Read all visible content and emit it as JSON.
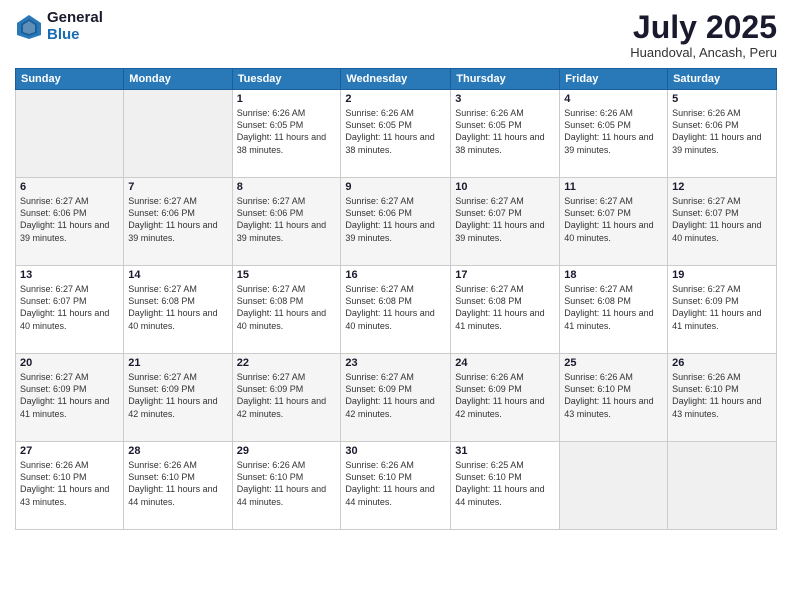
{
  "logo": {
    "general": "General",
    "blue": "Blue"
  },
  "title": "July 2025",
  "location": "Huandoval, Ancash, Peru",
  "days_of_week": [
    "Sunday",
    "Monday",
    "Tuesday",
    "Wednesday",
    "Thursday",
    "Friday",
    "Saturday"
  ],
  "weeks": [
    [
      {
        "day": "",
        "sunrise": "",
        "sunset": "",
        "daylight": ""
      },
      {
        "day": "",
        "sunrise": "",
        "sunset": "",
        "daylight": ""
      },
      {
        "day": "1",
        "sunrise": "Sunrise: 6:26 AM",
        "sunset": "Sunset: 6:05 PM",
        "daylight": "Daylight: 11 hours and 38 minutes."
      },
      {
        "day": "2",
        "sunrise": "Sunrise: 6:26 AM",
        "sunset": "Sunset: 6:05 PM",
        "daylight": "Daylight: 11 hours and 38 minutes."
      },
      {
        "day": "3",
        "sunrise": "Sunrise: 6:26 AM",
        "sunset": "Sunset: 6:05 PM",
        "daylight": "Daylight: 11 hours and 38 minutes."
      },
      {
        "day": "4",
        "sunrise": "Sunrise: 6:26 AM",
        "sunset": "Sunset: 6:05 PM",
        "daylight": "Daylight: 11 hours and 39 minutes."
      },
      {
        "day": "5",
        "sunrise": "Sunrise: 6:26 AM",
        "sunset": "Sunset: 6:06 PM",
        "daylight": "Daylight: 11 hours and 39 minutes."
      }
    ],
    [
      {
        "day": "6",
        "sunrise": "Sunrise: 6:27 AM",
        "sunset": "Sunset: 6:06 PM",
        "daylight": "Daylight: 11 hours and 39 minutes."
      },
      {
        "day": "7",
        "sunrise": "Sunrise: 6:27 AM",
        "sunset": "Sunset: 6:06 PM",
        "daylight": "Daylight: 11 hours and 39 minutes."
      },
      {
        "day": "8",
        "sunrise": "Sunrise: 6:27 AM",
        "sunset": "Sunset: 6:06 PM",
        "daylight": "Daylight: 11 hours and 39 minutes."
      },
      {
        "day": "9",
        "sunrise": "Sunrise: 6:27 AM",
        "sunset": "Sunset: 6:06 PM",
        "daylight": "Daylight: 11 hours and 39 minutes."
      },
      {
        "day": "10",
        "sunrise": "Sunrise: 6:27 AM",
        "sunset": "Sunset: 6:07 PM",
        "daylight": "Daylight: 11 hours and 39 minutes."
      },
      {
        "day": "11",
        "sunrise": "Sunrise: 6:27 AM",
        "sunset": "Sunset: 6:07 PM",
        "daylight": "Daylight: 11 hours and 40 minutes."
      },
      {
        "day": "12",
        "sunrise": "Sunrise: 6:27 AM",
        "sunset": "Sunset: 6:07 PM",
        "daylight": "Daylight: 11 hours and 40 minutes."
      }
    ],
    [
      {
        "day": "13",
        "sunrise": "Sunrise: 6:27 AM",
        "sunset": "Sunset: 6:07 PM",
        "daylight": "Daylight: 11 hours and 40 minutes."
      },
      {
        "day": "14",
        "sunrise": "Sunrise: 6:27 AM",
        "sunset": "Sunset: 6:08 PM",
        "daylight": "Daylight: 11 hours and 40 minutes."
      },
      {
        "day": "15",
        "sunrise": "Sunrise: 6:27 AM",
        "sunset": "Sunset: 6:08 PM",
        "daylight": "Daylight: 11 hours and 40 minutes."
      },
      {
        "day": "16",
        "sunrise": "Sunrise: 6:27 AM",
        "sunset": "Sunset: 6:08 PM",
        "daylight": "Daylight: 11 hours and 40 minutes."
      },
      {
        "day": "17",
        "sunrise": "Sunrise: 6:27 AM",
        "sunset": "Sunset: 6:08 PM",
        "daylight": "Daylight: 11 hours and 41 minutes."
      },
      {
        "day": "18",
        "sunrise": "Sunrise: 6:27 AM",
        "sunset": "Sunset: 6:08 PM",
        "daylight": "Daylight: 11 hours and 41 minutes."
      },
      {
        "day": "19",
        "sunrise": "Sunrise: 6:27 AM",
        "sunset": "Sunset: 6:09 PM",
        "daylight": "Daylight: 11 hours and 41 minutes."
      }
    ],
    [
      {
        "day": "20",
        "sunrise": "Sunrise: 6:27 AM",
        "sunset": "Sunset: 6:09 PM",
        "daylight": "Daylight: 11 hours and 41 minutes."
      },
      {
        "day": "21",
        "sunrise": "Sunrise: 6:27 AM",
        "sunset": "Sunset: 6:09 PM",
        "daylight": "Daylight: 11 hours and 42 minutes."
      },
      {
        "day": "22",
        "sunrise": "Sunrise: 6:27 AM",
        "sunset": "Sunset: 6:09 PM",
        "daylight": "Daylight: 11 hours and 42 minutes."
      },
      {
        "day": "23",
        "sunrise": "Sunrise: 6:27 AM",
        "sunset": "Sunset: 6:09 PM",
        "daylight": "Daylight: 11 hours and 42 minutes."
      },
      {
        "day": "24",
        "sunrise": "Sunrise: 6:26 AM",
        "sunset": "Sunset: 6:09 PM",
        "daylight": "Daylight: 11 hours and 42 minutes."
      },
      {
        "day": "25",
        "sunrise": "Sunrise: 6:26 AM",
        "sunset": "Sunset: 6:10 PM",
        "daylight": "Daylight: 11 hours and 43 minutes."
      },
      {
        "day": "26",
        "sunrise": "Sunrise: 6:26 AM",
        "sunset": "Sunset: 6:10 PM",
        "daylight": "Daylight: 11 hours and 43 minutes."
      }
    ],
    [
      {
        "day": "27",
        "sunrise": "Sunrise: 6:26 AM",
        "sunset": "Sunset: 6:10 PM",
        "daylight": "Daylight: 11 hours and 43 minutes."
      },
      {
        "day": "28",
        "sunrise": "Sunrise: 6:26 AM",
        "sunset": "Sunset: 6:10 PM",
        "daylight": "Daylight: 11 hours and 44 minutes."
      },
      {
        "day": "29",
        "sunrise": "Sunrise: 6:26 AM",
        "sunset": "Sunset: 6:10 PM",
        "daylight": "Daylight: 11 hours and 44 minutes."
      },
      {
        "day": "30",
        "sunrise": "Sunrise: 6:26 AM",
        "sunset": "Sunset: 6:10 PM",
        "daylight": "Daylight: 11 hours and 44 minutes."
      },
      {
        "day": "31",
        "sunrise": "Sunrise: 6:25 AM",
        "sunset": "Sunset: 6:10 PM",
        "daylight": "Daylight: 11 hours and 44 minutes."
      },
      {
        "day": "",
        "sunrise": "",
        "sunset": "",
        "daylight": ""
      },
      {
        "day": "",
        "sunrise": "",
        "sunset": "",
        "daylight": ""
      }
    ]
  ]
}
